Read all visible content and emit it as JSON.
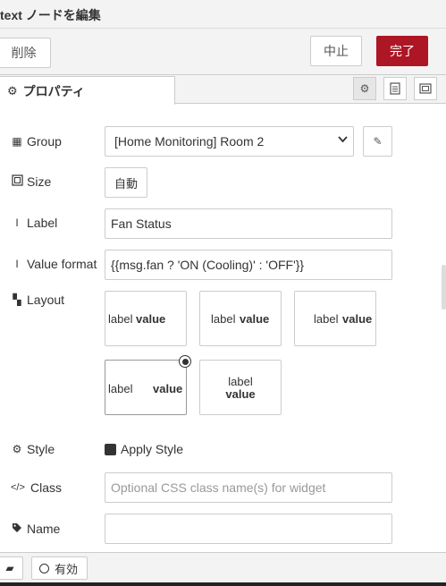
{
  "header": {
    "title": "text ノードを編集"
  },
  "toolbar": {
    "delete_label": "削除",
    "cancel_label": "中止",
    "done_label": "完了"
  },
  "tabs": {
    "properties_label": "プロパティ"
  },
  "form": {
    "group": {
      "label": "Group",
      "value": "[Home Monitoring] Room 2"
    },
    "size": {
      "label": "Size",
      "value": "自動"
    },
    "label_field": {
      "label": "Label",
      "value": "Fan Status"
    },
    "value_format": {
      "label": "Value format",
      "value": "{{msg.fan ? 'ON (Cooling)' : 'OFF'}}"
    },
    "layout": {
      "label": "Layout",
      "options": [
        {
          "label": "label",
          "value": "value"
        },
        {
          "label": "label",
          "value": "value"
        },
        {
          "label": "label",
          "value": "value"
        },
        {
          "label": "label",
          "value": "value"
        },
        {
          "label": "label",
          "value": "value"
        }
      ],
      "selected_index": 3
    },
    "style": {
      "label": "Style",
      "checkbox_label": "Apply Style"
    },
    "class_field": {
      "label": "Class",
      "placeholder": "Optional CSS class name(s) for widget"
    },
    "name_field": {
      "label": "Name",
      "value": ""
    }
  },
  "footer": {
    "enabled_label": "有効"
  },
  "colors": {
    "done_button": "#ad1625",
    "panel_bg": "#f3f3f3"
  }
}
